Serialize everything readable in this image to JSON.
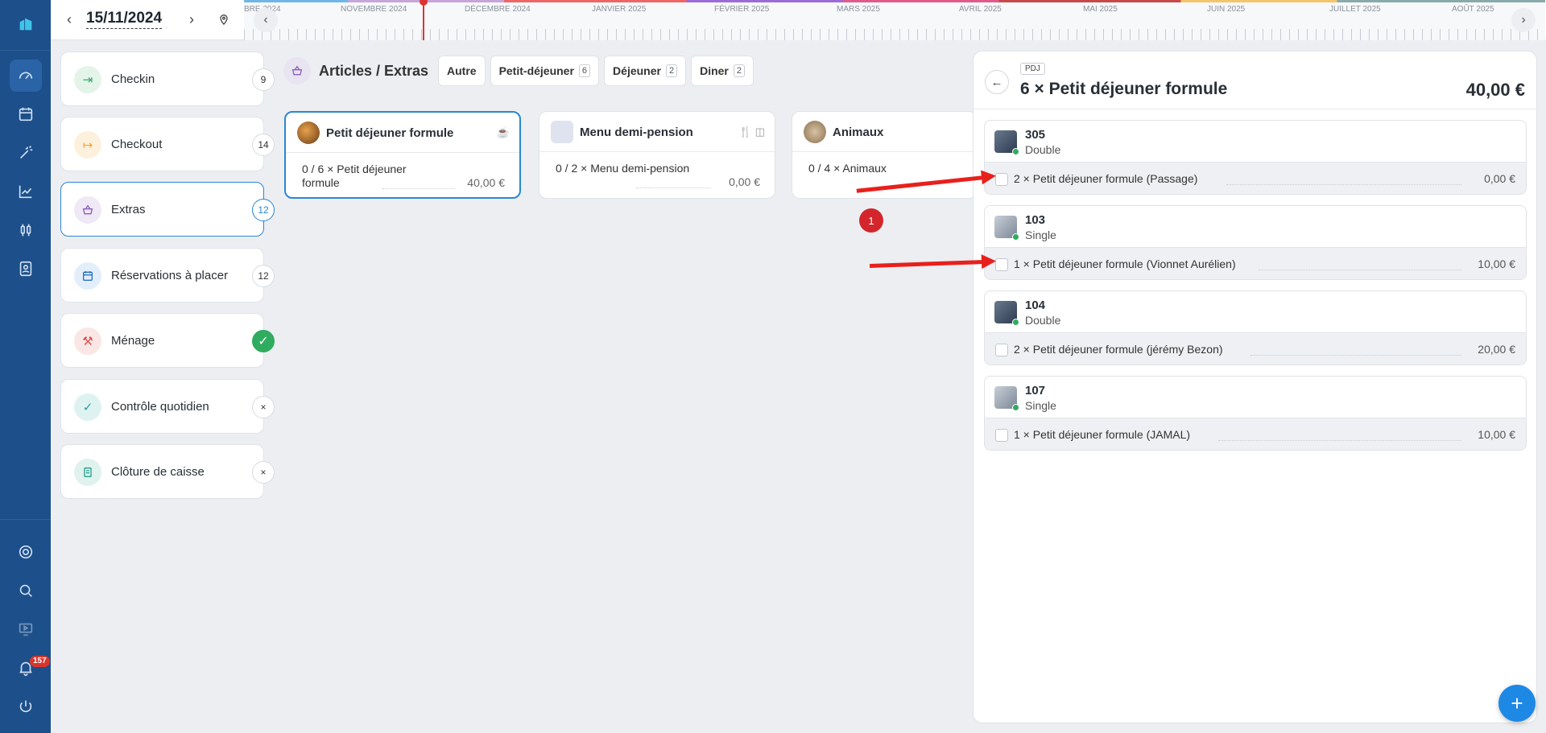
{
  "date": "15/11/2024",
  "timeline": {
    "months": [
      "BRE 2024",
      "NOVEMBRE 2024",
      "DÉCEMBRE 2024",
      "JANVIER 2025",
      "FÉVRIER 2025",
      "MARS 2025",
      "AVRIL 2025",
      "MAI 2025",
      "JUIN 2025",
      "JUILLET 2025",
      "AOÛT 2025"
    ]
  },
  "rail": {
    "notif_count": "157"
  },
  "tasks": [
    {
      "label": "Checkin",
      "count": "9",
      "icon": "login-icon"
    },
    {
      "label": "Checkout",
      "count": "14",
      "icon": "logout-icon"
    },
    {
      "label": "Extras",
      "count": "12",
      "icon": "basket-icon"
    },
    {
      "label": "Réservations à placer",
      "count": "12",
      "icon": "calendar-icon"
    },
    {
      "label": "Ménage",
      "count": "✓",
      "icon": "broom-icon"
    },
    {
      "label": "Contrôle quotidien",
      "count": "×",
      "icon": "check-icon"
    },
    {
      "label": "Clôture de caisse",
      "count": "×",
      "icon": "receipt-icon"
    }
  ],
  "articles": {
    "title": "Articles / Extras",
    "chips": [
      {
        "label": "Autre",
        "count": ""
      },
      {
        "label": "Petit-déjeuner",
        "count": "6"
      },
      {
        "label": "Déjeuner",
        "count": "2"
      },
      {
        "label": "Diner",
        "count": "2"
      }
    ],
    "products": [
      {
        "name": "Petit déjeuner formule",
        "desc": "0 / 6 × Petit déjeuner formule",
        "price": "40,00 €"
      },
      {
        "name": "Menu demi-pension",
        "desc": "0 / 2 × Menu demi-pension",
        "price": "0,00 €"
      },
      {
        "name": "Animaux",
        "desc": "0 / 4 × Animaux",
        "price": ""
      }
    ]
  },
  "marker": "1",
  "panel": {
    "tag": "PDJ",
    "title": "6 × Petit déjeuner formule",
    "total": "40,00 €",
    "rooms": [
      {
        "number": "305",
        "type": "Double",
        "line": "2 × Petit déjeuner formule (Passage)",
        "price": "0,00 €"
      },
      {
        "number": "103",
        "type": "Single",
        "line": "1 × Petit déjeuner formule (Vionnet Aurélien)",
        "price": "10,00 €"
      },
      {
        "number": "104",
        "type": "Double",
        "line": "2 × Petit déjeuner formule (jérémy Bezon)",
        "price": "20,00 €"
      },
      {
        "number": "107",
        "type": "Single",
        "line": "1 × Petit déjeuner formule (JAMAL)",
        "price": "10,00 €"
      }
    ]
  },
  "fab_label": "+"
}
